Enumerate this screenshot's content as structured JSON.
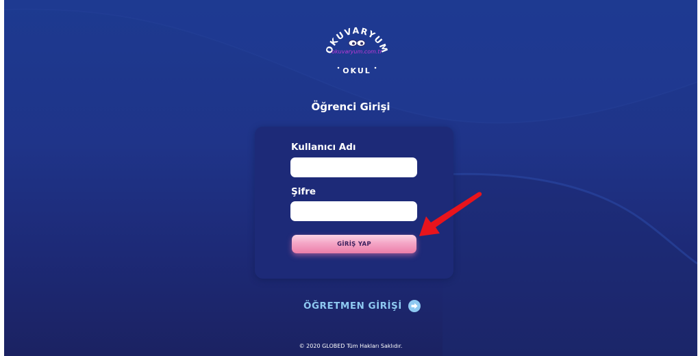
{
  "logo": {
    "arc_top": "OKUVARYUM",
    "site": "okuvaryum.com.tr",
    "bottom": "OKUL"
  },
  "page_title": "Öğrenci Girişi",
  "form": {
    "username_label": "Kullanıcı Adı",
    "username_value": "",
    "password_label": "Şifre",
    "password_value": "",
    "submit_label": "GİRİŞ YAP"
  },
  "teacher_link": {
    "label": "ÖĞRETMEN GİRİŞİ",
    "icon": "arrow-right-circle-icon"
  },
  "footer": {
    "copyright": "© 2020 GLOBED Tüm Hakları Saklıdır."
  },
  "annotation": {
    "icon": "red-arrow-icon",
    "color": "#e8141c"
  },
  "colors": {
    "background": "#1f3489",
    "card": "#1d2a78",
    "button": "#f4a6c6",
    "teacher_link": "#8ec9f1"
  }
}
